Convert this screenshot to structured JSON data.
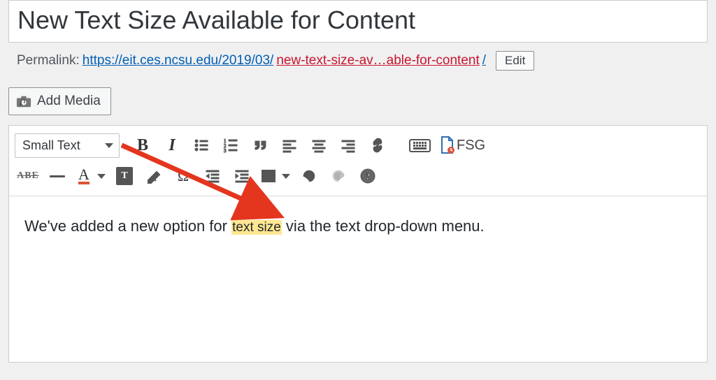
{
  "title": "New Text Size Available for Content",
  "permalink": {
    "label": "Permalink: ",
    "base_url": "https://eit.ces.ncsu.edu/2019/03/",
    "slug": "new-text-size-av…able-for-content",
    "trail": "/",
    "edit_label": "Edit"
  },
  "add_media_label": "Add Media",
  "toolbar": {
    "format_select": "Small Text",
    "fsg_label": "FSG",
    "abe_label": "ABE",
    "omega": "Ω",
    "paste_T": "T",
    "help": "?"
  },
  "content": {
    "prefix": "We've added a new option for ",
    "highlight": "text size",
    "suffix": " via the text drop-down menu."
  }
}
